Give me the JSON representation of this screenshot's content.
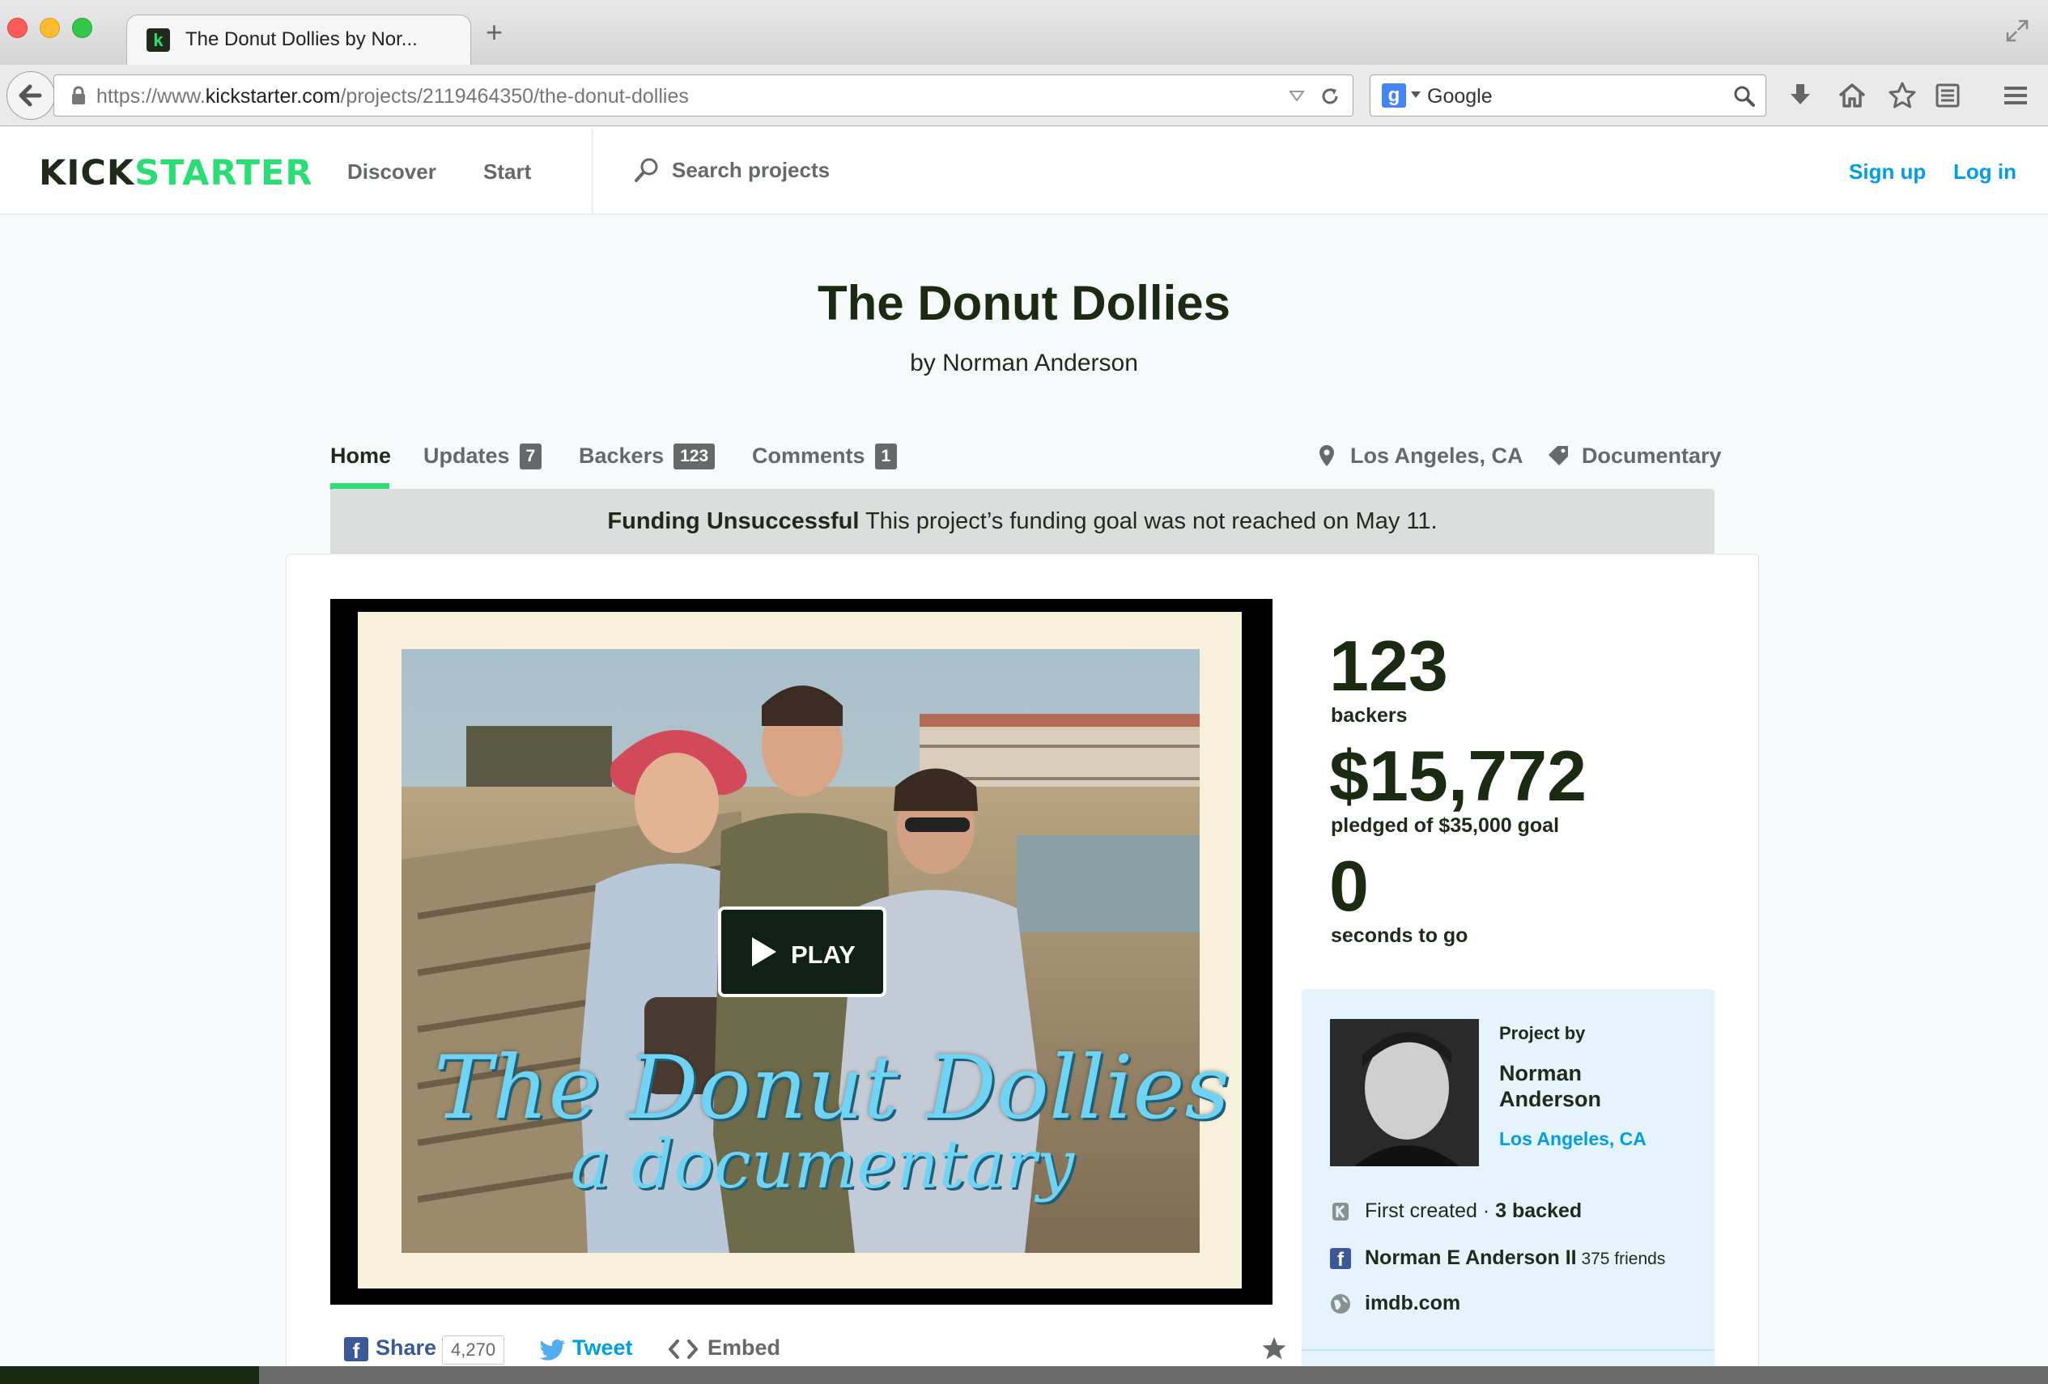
{
  "browser": {
    "tab_title": "The Donut Dollies by Nor...",
    "url_prefix": "https://www.",
    "url_domain": "kickstarter.com",
    "url_path": "/projects/2119464350/the-donut-dollies",
    "search_provider": "Google",
    "new_tab_label": "+"
  },
  "header": {
    "logo_kick": "KICK",
    "logo_starter": "STARTER",
    "nav_discover": "Discover",
    "nav_start": "Start",
    "search_placeholder": "Search projects",
    "sign_up": "Sign up",
    "log_in": "Log in"
  },
  "project": {
    "title": "The Donut Dollies",
    "byline": "by Norman Anderson",
    "tabs": {
      "home": "Home",
      "updates": "Updates",
      "updates_count": "7",
      "backers": "Backers",
      "backers_count": "123",
      "comments": "Comments",
      "comments_count": "1"
    },
    "location": "Los Angeles, CA",
    "category": "Documentary",
    "status_bold": "Funding Unsuccessful",
    "status_text": " This project’s funding goal was not reached on May 11."
  },
  "video": {
    "overlay_title": "The Donut Dollies",
    "overlay_subtitle": "a documentary",
    "play_label": "PLAY"
  },
  "share": {
    "fb_label": "Share",
    "fb_count": "4,270",
    "tweet_label": "Tweet",
    "embed_label": "Embed"
  },
  "stats": {
    "backers_value": "123",
    "backers_label": "backers",
    "pledged_value": "$15,772",
    "pledged_label": "pledged of $35,000 goal",
    "time_value": "0",
    "time_label": "seconds to go"
  },
  "creator": {
    "project_by": "Project by",
    "name": "Norman Anderson",
    "location": "Los Angeles, CA",
    "first_created": "First created · ",
    "backed": "3 backed",
    "facebook_name": "Norman E Anderson II",
    "facebook_friends": " 375 friends",
    "website": "imdb.com"
  },
  "colors": {
    "kickstarter_green": "#2bde73",
    "dark_green": "#1f2a1a",
    "link_blue": "#009ee5",
    "facebook_blue": "#3b5998",
    "twitter_blue": "#55acee",
    "status_banner": "#dcdede",
    "creator_card_bg": "#e5f3fd"
  }
}
